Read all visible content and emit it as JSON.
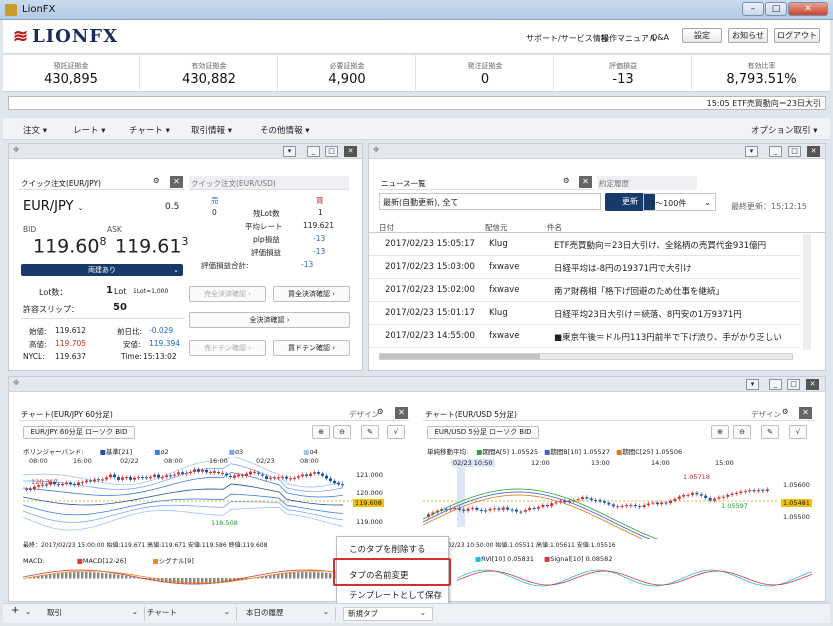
{
  "window": {
    "title": "LionFX"
  },
  "header": {
    "logo": "LIONFX",
    "links": [
      "サポート/サービス情報",
      "操作マニュアル",
      "Q&A"
    ],
    "buttons": [
      "設定",
      "お知らせ",
      "ログアウト"
    ]
  },
  "stats": [
    {
      "label": "預託証拠金",
      "value": "430,895"
    },
    {
      "label": "有効証拠金",
      "value": "430,882"
    },
    {
      "label": "必要証拠金",
      "value": "4,900"
    },
    {
      "label": "発注証拠金",
      "value": "0"
    },
    {
      "label": "評価損益",
      "value": "-13"
    },
    {
      "label": "有効比率",
      "value": "8,793.51%"
    }
  ],
  "ticker": "15:05 ETF売買動向＝23日大引",
  "menubar": {
    "items": [
      "注文",
      "レート",
      "チャート",
      "取引情報",
      "その他情報"
    ],
    "right": "オプション取引"
  },
  "quick_order": {
    "tab1": "クイック注文(EUR/JPY)",
    "tab2": "クイック注文(EUR/USD)",
    "pair": "EUR/JPY",
    "spread": "0.5",
    "bid_label": "BID",
    "ask_label": "ASK",
    "bid_main": "119.60",
    "bid_sup": "8",
    "ask_main": "119.61",
    "ask_sup": "3",
    "mode": "両建あり",
    "lot_label": "Lot数：",
    "lot_value": "1",
    "lot_unit": "Lot",
    "lot_note": "1Lot=1,000",
    "slip_label": "許容スリップ：",
    "slip_value": "50",
    "open_label": "始値:",
    "open_value": "119.612",
    "prev_label": "前日比:",
    "prev_value": "-0.029",
    "high_label": "高値:",
    "high_value": "119.705",
    "low_label": "安値:",
    "low_value": "119.394",
    "nycl_label": "NYCL:",
    "nycl_value": "119.637",
    "time_label": "Time:",
    "time_value": "15:13:02",
    "sell_label": "売",
    "sell_value": "0",
    "buy_label": "買",
    "buy_value": "1",
    "rows": [
      {
        "label": "残Lot数",
        "value": "1"
      },
      {
        "label": "平均レート",
        "value": "119.621"
      },
      {
        "label": "pip損益",
        "value": "-13"
      },
      {
        "label": "評価損益",
        "value": "-13"
      }
    ],
    "eval_total_label": "評価損益合計:",
    "eval_total_value": "-13",
    "btn_sell_settle": "売全決済確認",
    "btn_buy_settle": "買全決済確認",
    "btn_all_settle": "全決済確認",
    "btn_sell_doten": "売ドテン確認",
    "btn_buy_doten": "買ドテン確認"
  },
  "news": {
    "tab1": "ニュース一覧",
    "tab2": "約定履歴",
    "filter": "最新(自動更新), 全て",
    "update_btn": "更新",
    "range": "1～100件",
    "last_update": "最終更新：",
    "last_update_time": "15:12:15",
    "headers": [
      "日付",
      "配信元",
      "件名"
    ],
    "rows": [
      {
        "date": "2017/02/23 15:05:17",
        "source": "Klug",
        "title": "ETF売買動向＝23日大引け、全銘柄の売買代金931億円"
      },
      {
        "date": "2017/02/23 15:03:00",
        "source": "fxwave",
        "title": "日経平均は-8円の19371円で大引け"
      },
      {
        "date": "2017/02/23 15:02:00",
        "source": "fxwave",
        "title": "南ア財務相「格下げ回避のため仕事を継続」"
      },
      {
        "date": "2017/02/23 15:01:17",
        "source": "Klug",
        "title": "日経平均23日大引け＝続落、8円安の1万9371円"
      },
      {
        "date": "2017/02/23 14:55:00",
        "source": "fxwave",
        "title": "■東京午後＝ドル円113円前半で下げ渋り、手がかり乏しい"
      }
    ]
  },
  "chart1": {
    "tab": "チャート(EUR/JPY 60分足)",
    "design": "デザイン",
    "selector": "EUR/JPY 60分足 ローソク BID",
    "legend_title": "ボリンジャーバンド:",
    "legend_items": [
      "基準[21]",
      "σ2",
      "σ3",
      "σ4"
    ],
    "time_labels": [
      "08:00",
      "16:00",
      "02/22",
      "08:00",
      "16:00",
      "02/23",
      "08:00"
    ],
    "price_labels": [
      "121.000",
      "120.000",
      "119.608",
      "119.000"
    ],
    "current_price": "119.608",
    "hi_mark": "120.317",
    "lo_mark": "118.508",
    "footer": "最終：2017/02/23 15:00:00 始値:119.671 高値:119.671 安値:119.586 終値:119.608",
    "macd_label": "MACD:",
    "macd_items": [
      "MACD[12-26]",
      "シグナル[9]"
    ]
  },
  "chart2": {
    "tab": "チャート(EUR/USD 5分足)",
    "design": "デザイン",
    "selector": "EUR/USD 5分足 ローソク BID",
    "legend_title": "単純移動平均:",
    "legend_items": [
      "期間A[5] 1.05525",
      "期間B[10] 1.05527",
      "期間C[25] 1.05506"
    ],
    "time_labels": [
      "02/23 10:50",
      "12:00",
      "13:00",
      "14:00",
      "15:00"
    ],
    "price_labels": [
      "1.05600",
      "1.05500",
      "1.05481"
    ],
    "current_price": "1.05481",
    "hi_mark": "1.05718",
    "lo_mark": "1.05597",
    "footer": "+ 2017/02/23 10:50:00 始値:1.05511 高値:1.05611 安値:1.05516",
    "rvi_items": [
      "RVI[10] 0.05831",
      "Signal[10] 0.08582"
    ]
  },
  "context_menu": {
    "items": [
      "このタブを削除する",
      "タブの名前変更",
      "テンプレートとして保存"
    ],
    "highlight_color": "#d32f2f"
  },
  "bottom_tabs": [
    "取引",
    "チャート",
    "本日の履歴",
    "新規タブ"
  ],
  "colors": {
    "navy": "#163a69",
    "blue": "#1b67c9",
    "red": "#c62828"
  }
}
